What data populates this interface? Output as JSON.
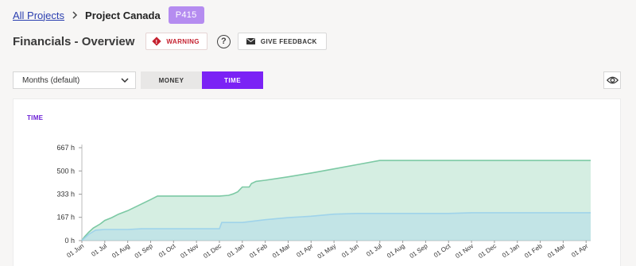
{
  "breadcrumb": {
    "all_projects": "All Projects",
    "separator_icon": "chevron-right-icon",
    "current": "Project Canada",
    "project_code": "P415"
  },
  "header": {
    "title": "Financials - Overview",
    "warning_label": "WARNING",
    "help_label": "?",
    "feedback_label": "GIVE FEEDBACK"
  },
  "controls": {
    "period_select": "Months (default)",
    "money_label": "MONEY",
    "time_label": "TIME",
    "active_toggle": "TIME"
  },
  "colors": {
    "accent": "#7b22f5",
    "badge": "#b58cf0",
    "warning": "#c5212f",
    "series_green": "#7cc9a4",
    "series_blue": "#9fd3ea"
  },
  "chart_data": {
    "type": "area",
    "title": "TIME",
    "ylabel": "",
    "xlabel": "",
    "y_unit": "h",
    "ylim": [
      0,
      667
    ],
    "y_ticks": [
      "0 h",
      "167 h",
      "333 h",
      "500 h",
      "667 h"
    ],
    "y_tick_values": [
      0,
      167,
      333,
      500,
      667
    ],
    "x_ticks": [
      "01 Jun",
      "01 Jul",
      "01 Aug",
      "01 Sep",
      "01 Oct",
      "01 Nov",
      "01 Dec",
      "01 Jan",
      "01 Feb",
      "01 Mar",
      "01 Apr",
      "01 May",
      "01 Jun",
      "01 Jul",
      "01 Aug",
      "01 Sep",
      "01 Oct",
      "01 Nov",
      "01 Dec",
      "01 Jan",
      "01 Feb",
      "01 Mar",
      "01 Apr"
    ],
    "grid": false,
    "legend": "none",
    "series": [
      {
        "color": "#7cc9a4",
        "points": [
          [
            0,
            0
          ],
          [
            0.1,
            25
          ],
          [
            0.3,
            60
          ],
          [
            0.5,
            90
          ],
          [
            0.8,
            120
          ],
          [
            1,
            145
          ],
          [
            1.3,
            165
          ],
          [
            1.6,
            190
          ],
          [
            2,
            215
          ],
          [
            2.5,
            255
          ],
          [
            3,
            295
          ],
          [
            3.3,
            320
          ],
          [
            4,
            320
          ],
          [
            5,
            320
          ],
          [
            6,
            320
          ],
          [
            6.4,
            325
          ],
          [
            6.6,
            335
          ],
          [
            6.8,
            350
          ],
          [
            7,
            385
          ],
          [
            7.3,
            385
          ],
          [
            7.4,
            410
          ],
          [
            7.6,
            425
          ],
          [
            8,
            433
          ],
          [
            9,
            458
          ],
          [
            10,
            485
          ],
          [
            11,
            515
          ],
          [
            12,
            545
          ],
          [
            13,
            575
          ],
          [
            14,
            575
          ],
          [
            15,
            575
          ],
          [
            16,
            575
          ],
          [
            17,
            575
          ],
          [
            18,
            575
          ],
          [
            19,
            575
          ],
          [
            20,
            575
          ],
          [
            21,
            575
          ],
          [
            22.2,
            575
          ]
        ]
      },
      {
        "color": "#9fd3ea",
        "points": [
          [
            0,
            0
          ],
          [
            0.3,
            45
          ],
          [
            0.6,
            75
          ],
          [
            1,
            80
          ],
          [
            2,
            80
          ],
          [
            2.6,
            85
          ],
          [
            3,
            85
          ],
          [
            4,
            85
          ],
          [
            5,
            85
          ],
          [
            6,
            85
          ],
          [
            6.1,
            130
          ],
          [
            7,
            130
          ],
          [
            7.5,
            140
          ],
          [
            8,
            150
          ],
          [
            9,
            165
          ],
          [
            10,
            175
          ],
          [
            11,
            190
          ],
          [
            12,
            195
          ],
          [
            13,
            195
          ],
          [
            14,
            195
          ],
          [
            15,
            195
          ],
          [
            16,
            195
          ],
          [
            17,
            200
          ],
          [
            18,
            200
          ],
          [
            19,
            200
          ],
          [
            20,
            200
          ],
          [
            21,
            200
          ],
          [
            22.2,
            200
          ]
        ]
      }
    ]
  }
}
